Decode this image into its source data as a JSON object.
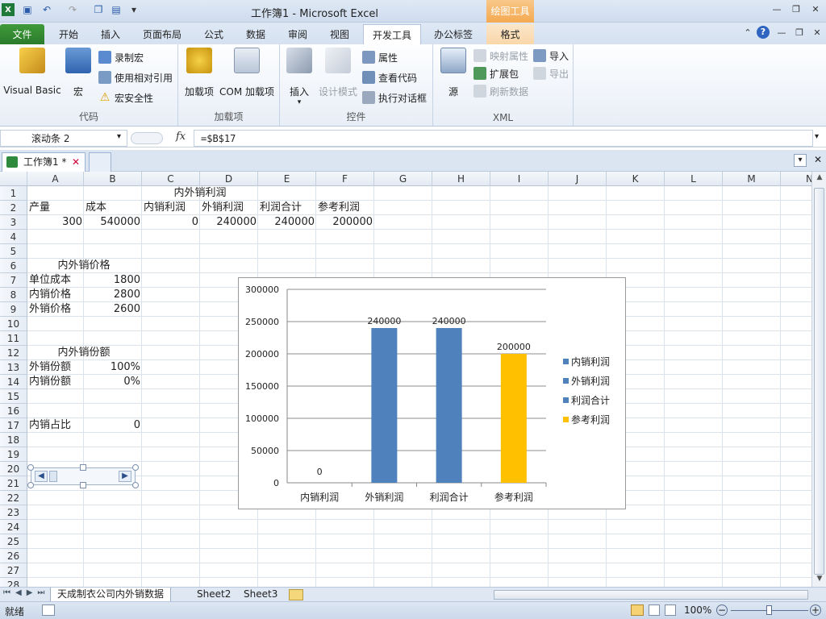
{
  "window": {
    "title": "工作簿1  -  Microsoft Excel",
    "context_tab": "绘图工具"
  },
  "tabs": [
    "文件",
    "开始",
    "插入",
    "页面布局",
    "公式",
    "数据",
    "审阅",
    "视图",
    "开发工具",
    "办公标签",
    "格式"
  ],
  "ribbon": {
    "code": {
      "label": "代码",
      "visual_basic": "Visual Basic",
      "macros": "宏",
      "record_macro": "录制宏",
      "relative_ref": "使用相对引用",
      "macro_security": "宏安全性"
    },
    "addins": {
      "label": "加载项",
      "addins": "加载项",
      "com_addins": "COM 加载项"
    },
    "controls": {
      "label": "控件",
      "insert": "插入",
      "design_mode": "设计模式",
      "properties": "属性",
      "view_code": "查看代码",
      "run_dialog": "执行对话框"
    },
    "xml": {
      "label": "XML",
      "source": "源",
      "map_properties": "映射属性",
      "expansion_packs": "扩展包",
      "refresh_data": "刷新数据",
      "import": "导入",
      "export": "导出"
    }
  },
  "formula_bar": {
    "name_box": "滚动条 2",
    "fx": "fx",
    "formula": "=$B$17"
  },
  "workbook_tab": "工作簿1 *",
  "columns": [
    "A",
    "B",
    "C",
    "D",
    "E",
    "F",
    "G",
    "H",
    "I",
    "J",
    "K",
    "L",
    "M",
    "N"
  ],
  "rows": [
    "1",
    "2",
    "3",
    "4",
    "5",
    "6",
    "7",
    "8",
    "9",
    "10",
    "11",
    "12",
    "13",
    "14",
    "15",
    "16",
    "17",
    "18",
    "19",
    "20",
    "21",
    "22",
    "23",
    "24",
    "25",
    "26",
    "27",
    "28"
  ],
  "cells": {
    "C1": "内外销利润",
    "A2": "产量",
    "B2": "成本",
    "C2": "内销利润",
    "D2": "外销利润",
    "E2": "利润合计",
    "F2": "参考利润",
    "A3": "300",
    "B3": "540000",
    "C3": "0",
    "D3": "240000",
    "E3": "240000",
    "F3": "200000",
    "A6": "内外销价格",
    "A7": "单位成本",
    "B7": "1800",
    "A8": "内销价格",
    "B8": "2800",
    "A9": "外销价格",
    "B9": "2600",
    "A12": "内外销份额",
    "A13": "外销份额",
    "B13": "100%",
    "A14": "内销份额",
    "B14": "0%",
    "A17": "内销占比",
    "B17": "0"
  },
  "chart_data": {
    "type": "bar",
    "categories": [
      "内销利润",
      "外销利润",
      "利润合计",
      "参考利润"
    ],
    "values": [
      0,
      240000,
      240000,
      200000
    ],
    "data_labels": [
      "0",
      "240000",
      "240000",
      "200000"
    ],
    "colors": [
      "#4f81bd",
      "#4f81bd",
      "#4f81bd",
      "#ffc000"
    ],
    "legend": [
      "内销利润",
      "外销利润",
      "利润合计",
      "参考利润"
    ],
    "legend_position": "right",
    "ylim": [
      0,
      300000
    ],
    "yticks": [
      "0",
      "50000",
      "100000",
      "150000",
      "200000",
      "250000",
      "300000"
    ],
    "grid": true
  },
  "sheets": [
    "天成制衣公司内外销数据",
    "Sheet2",
    "Sheet3"
  ],
  "status": {
    "ready": "就绪",
    "zoom": "100%"
  }
}
